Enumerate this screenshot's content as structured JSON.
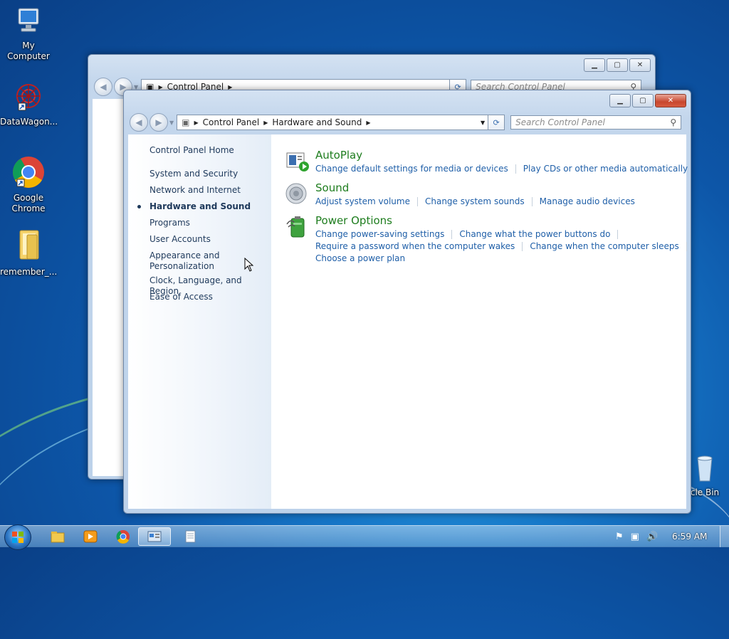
{
  "desktop": {
    "icons": [
      {
        "label": "My Computer"
      },
      {
        "label": "DataWagon..."
      },
      {
        "label": "Google Chrome"
      },
      {
        "label": "remember_..."
      },
      {
        "label": "cle Bin"
      }
    ]
  },
  "back_window": {
    "breadcrumb": [
      "Control Panel"
    ],
    "search_placeholder": "Search Control Panel"
  },
  "window": {
    "breadcrumb": [
      "Control Panel",
      "Hardware and Sound"
    ],
    "search_placeholder": "Search Control Panel",
    "sidebar": {
      "home": "Control Panel Home",
      "items": [
        {
          "label": "System and Security"
        },
        {
          "label": "Network and Internet"
        },
        {
          "label": "Hardware and Sound",
          "active": true
        },
        {
          "label": "Programs"
        },
        {
          "label": "User Accounts"
        },
        {
          "label": "Appearance and Personalization"
        },
        {
          "label": "Clock, Language, and Region"
        },
        {
          "label": "Ease of Access"
        }
      ]
    },
    "categories": [
      {
        "title": "AutoPlay",
        "icon": "autoplay-icon",
        "links": [
          "Change default settings for media or devices",
          "Play CDs or other media automatically"
        ]
      },
      {
        "title": "Sound",
        "icon": "speaker-icon",
        "links": [
          "Adjust system volume",
          "Change system sounds",
          "Manage audio devices"
        ]
      },
      {
        "title": "Power Options",
        "icon": "battery-icon",
        "links": [
          "Change power-saving settings",
          "Change what the power buttons do",
          "Require a password when the computer wakes",
          "Change when the computer sleeps",
          "Choose a power plan"
        ]
      }
    ]
  },
  "taskbar": {
    "clock": "6:59 AM",
    "items": [
      "windows-explorer-icon",
      "media-player-icon",
      "chrome-icon",
      "control-panel-icon",
      "notepad-icon"
    ]
  },
  "colors": {
    "link": "#1f5fa8",
    "category_title": "#1e7d1e",
    "sidebar_text": "#1e395b"
  }
}
